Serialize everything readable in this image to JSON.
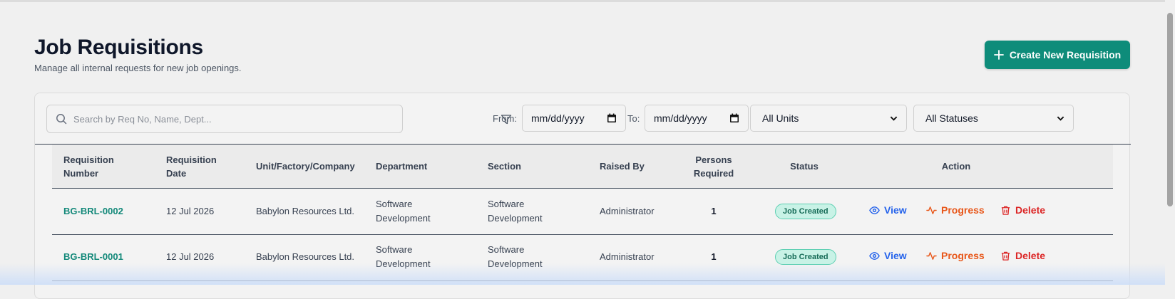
{
  "header": {
    "title": "Job Requisitions",
    "subtitle": "Manage all internal requests for new job openings.",
    "create_label": "Create New Requisition"
  },
  "filters": {
    "search_placeholder": "Search by Req No, Name, Dept...",
    "from_label": "From:",
    "to_label": "To:",
    "from_value": "mm/dd/yyyy",
    "to_value": "mm/dd/yyyy",
    "units_selected": "All Units",
    "status_selected": "All Statuses"
  },
  "table": {
    "columns": {
      "req_no": [
        "Requisition",
        "Number"
      ],
      "req_date": [
        "Requisition",
        "Date"
      ],
      "unit": "Unit/Factory/Company",
      "department": "Department",
      "section": "Section",
      "raised_by": "Raised By",
      "persons": [
        "Persons",
        "Required"
      ],
      "status": "Status",
      "action": "Action"
    },
    "rows": [
      {
        "req_no": "BG-BRL-0002",
        "date": "12 Jul 2026",
        "unit": "Babylon Resources Ltd.",
        "department": [
          "Software",
          "Development"
        ],
        "section": [
          "Software",
          "Development"
        ],
        "raised_by": "Administrator",
        "persons": "1",
        "status": "Job Created"
      },
      {
        "req_no": "BG-BRL-0001",
        "date": "12 Jul 2026",
        "unit": "Babylon Resources Ltd.",
        "department": [
          "Software",
          "Development"
        ],
        "section": [
          "Software",
          "Development"
        ],
        "raised_by": "Administrator",
        "persons": "1",
        "status": "Job Created"
      }
    ],
    "actions": {
      "view": "View",
      "progress": "Progress",
      "delete": "Delete"
    }
  },
  "colors": {
    "primary": "#0e8c7a",
    "link": "#14897a",
    "view": "#2563eb",
    "progress": "#e8571a",
    "delete": "#dc2626",
    "badge_bg": "#c8f2e6"
  }
}
